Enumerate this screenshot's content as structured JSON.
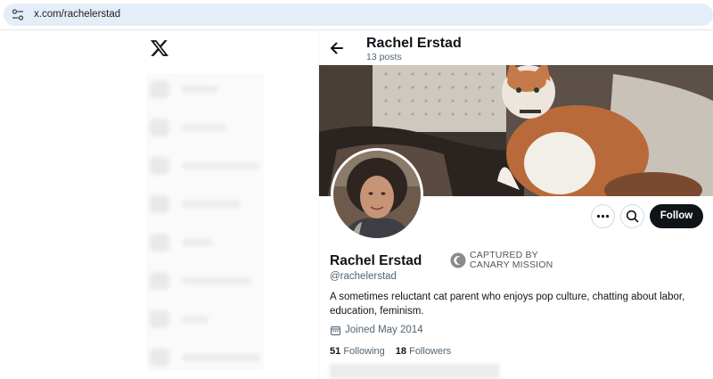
{
  "browser": {
    "url": "x.com/rachelerstad",
    "site_icon": "site-settings-icon"
  },
  "nav": {
    "logo": "x-logo-icon"
  },
  "header": {
    "name": "Rachel Erstad",
    "post_count": "13 posts",
    "back_icon": "back-arrow-icon"
  },
  "profile": {
    "name": "Rachel Erstad",
    "handle": "@rachelerstad",
    "bio": "A sometimes reluctant cat parent who enjoys pop culture, chatting about labor, education, feminism.",
    "joined": "Joined May 2014",
    "following_count": "51",
    "following_label": "Following",
    "followers_count": "18",
    "followers_label": "Followers"
  },
  "actions": {
    "follow_label": "Follow",
    "more_icon": "more-options-icon",
    "search_icon": "search-icon"
  },
  "watermark": {
    "line1": "CAPTURED BY",
    "line2": "CANARY MISSION"
  },
  "colors": {
    "follow_button_bg": "#0f1419",
    "address_bar_bg": "#e4eef8",
    "secondary_text": "#536471"
  }
}
